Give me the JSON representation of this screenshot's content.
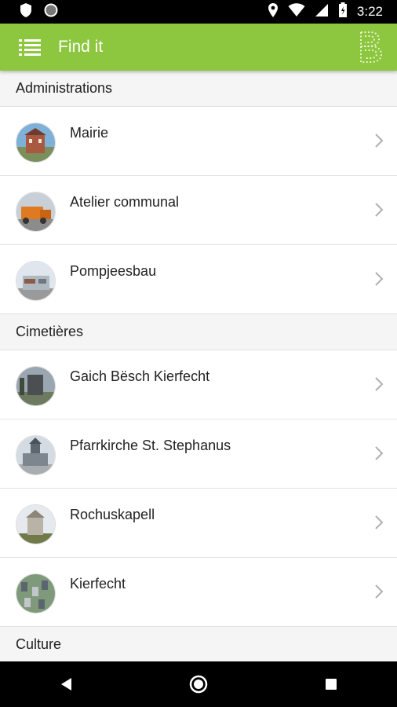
{
  "status_bar": {
    "time": "3:22",
    "left_icons": [
      "shield-icon",
      "circle-icon"
    ],
    "right_icons": [
      "location-icon",
      "wifi-icon",
      "signal-icon",
      "battery-icon"
    ]
  },
  "app_bar": {
    "title": "Find it",
    "menu_icon": "list-menu-icon",
    "logo_icon": "brand-logo-icon",
    "color": "#8dc63f"
  },
  "sections": [
    {
      "title": "Administrations",
      "items": [
        {
          "label": "Mairie",
          "thumb_colors": [
            "#7fb0d8",
            "#a8593f",
            "#7a8f5a"
          ]
        },
        {
          "label": "Atelier communal",
          "thumb_colors": [
            "#c9cfd6",
            "#e07a20",
            "#5c5c5c"
          ]
        },
        {
          "label": "Pompjeesbau",
          "thumb_colors": [
            "#dfe6ee",
            "#b0b8c0",
            "#8a5a4a"
          ]
        }
      ]
    },
    {
      "title": "Cimetières",
      "items": [
        {
          "label": "Gaich Bësch Kierfecht",
          "thumb_colors": [
            "#9aa6b0",
            "#4b4f52",
            "#6d7a60"
          ]
        },
        {
          "label": "Pfarrkirche St. Stephanus",
          "thumb_colors": [
            "#d5dbe2",
            "#5e6670",
            "#a9adb1"
          ]
        },
        {
          "label": "Rochuskapell",
          "thumb_colors": [
            "#e6e9ee",
            "#b9b2a6",
            "#6f7a48"
          ]
        },
        {
          "label": "Kierfecht",
          "thumb_colors": [
            "#7f9a7a",
            "#5b6570",
            "#c2c6cb"
          ]
        }
      ]
    },
    {
      "title": "Culture",
      "items": []
    }
  ],
  "nav_bar": {
    "buttons": [
      "back-icon",
      "home-icon",
      "recents-icon"
    ]
  }
}
